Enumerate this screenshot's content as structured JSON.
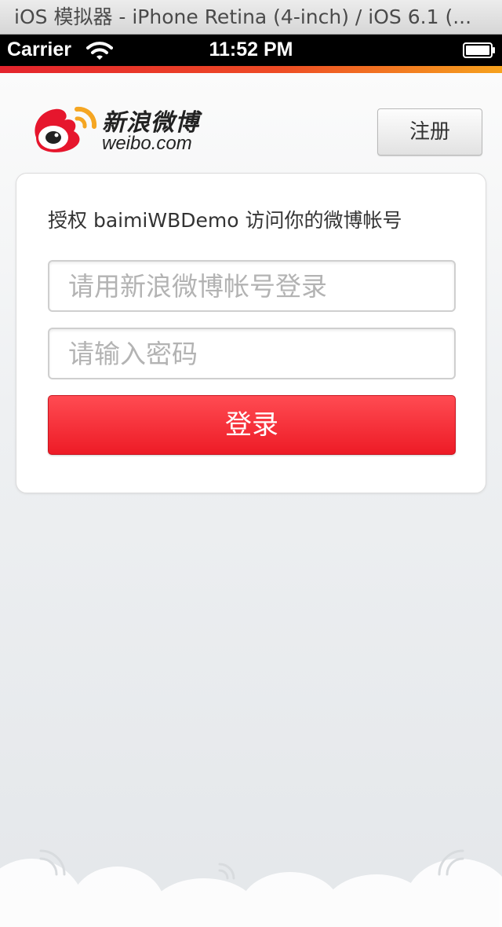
{
  "window": {
    "title": "iOS 模拟器 - iPhone Retina (4-inch) / iOS 6.1 (..."
  },
  "status_bar": {
    "carrier": "Carrier",
    "time": "11:52 PM",
    "wifi_icon": "wifi-icon",
    "battery_icon": "battery-icon"
  },
  "header": {
    "logo_cn": "新浪微博",
    "logo_en": "weibo.com",
    "register_label": "注册"
  },
  "login_card": {
    "authorize_text": "授权 baimiWBDemo 访问你的微博帐号",
    "username": {
      "placeholder": "请用新浪微博帐号登录",
      "value": ""
    },
    "password": {
      "placeholder": "请输入密码",
      "value": ""
    },
    "login_label": "登录"
  },
  "colors": {
    "accent_red": "#ed1b26",
    "accent_orange": "#f6a21e",
    "card_background": "#ffffff"
  }
}
